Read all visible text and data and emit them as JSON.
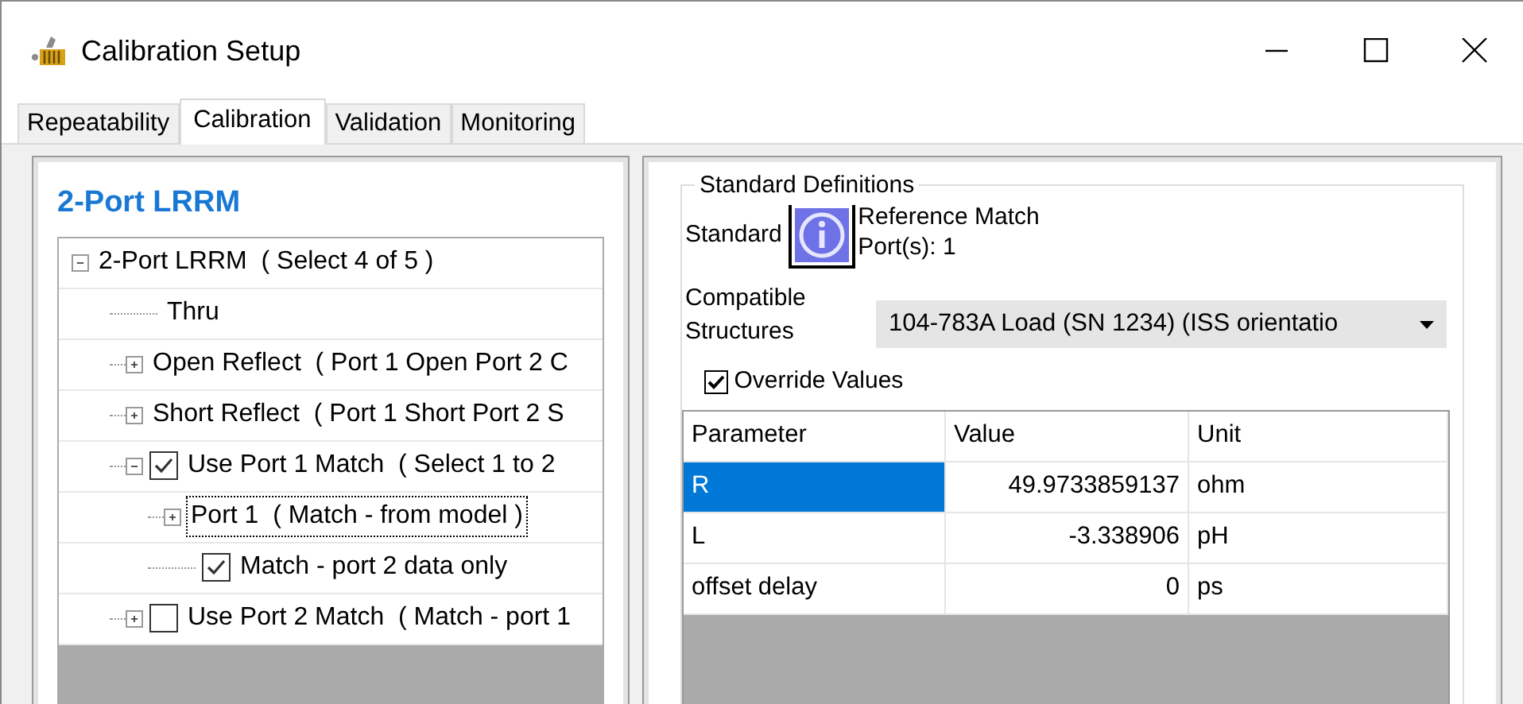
{
  "window": {
    "title": "Calibration Setup"
  },
  "tabs": [
    {
      "label": "Repeatability",
      "selected": false
    },
    {
      "label": "Calibration",
      "selected": true
    },
    {
      "label": "Validation",
      "selected": false
    },
    {
      "label": "Monitoring",
      "selected": false
    }
  ],
  "left_panel": {
    "heading": "2-Port LRRM",
    "tree": [
      {
        "label": "2-Port LRRM  ( Select 4 of 5 )",
        "expanded": true,
        "selected": false,
        "children": [
          {
            "label": "Thru",
            "selected": false
          },
          {
            "label": "Open Reflect  ( Port 1 Open Port 2 C",
            "expanded": false,
            "selected": false
          },
          {
            "label": "Short Reflect  ( Port 1 Short Port 2 S",
            "expanded": false,
            "selected": false
          },
          {
            "label": "Use Port 1 Match  ( Select 1 to 2",
            "expanded": true,
            "checked": true,
            "selected": false,
            "children": [
              {
                "label": "Port 1  ( Match - from model )",
                "expanded": false,
                "selected": true
              },
              {
                "label": "Match - port 2 data only",
                "checked": true,
                "selected": false
              }
            ]
          },
          {
            "label": "Use Port 2 Match  ( Match - port 1",
            "expanded": false,
            "checked": false,
            "selected": false
          }
        ]
      }
    ]
  },
  "right_panel": {
    "group_title": "Standard Definitions",
    "standard_label": "Standard",
    "standard_name": "Reference Match",
    "standard_ports": "Port(s): 1",
    "structures_label": "Compatible Structures",
    "structures_value": "104-783A Load (SN 1234)  (ISS orientatio",
    "override": {
      "label": "Override Values",
      "checked": true
    },
    "table": {
      "columns": [
        "Parameter",
        "Value",
        "Unit"
      ],
      "rows": [
        {
          "cells": [
            "R",
            "49.9733859137",
            "ohm"
          ],
          "selected": true
        },
        {
          "cells": [
            "L",
            "-3.338906",
            "pH"
          ],
          "selected": false
        },
        {
          "cells": [
            "offset delay",
            "0",
            "ps"
          ],
          "selected": false
        }
      ]
    }
  }
}
